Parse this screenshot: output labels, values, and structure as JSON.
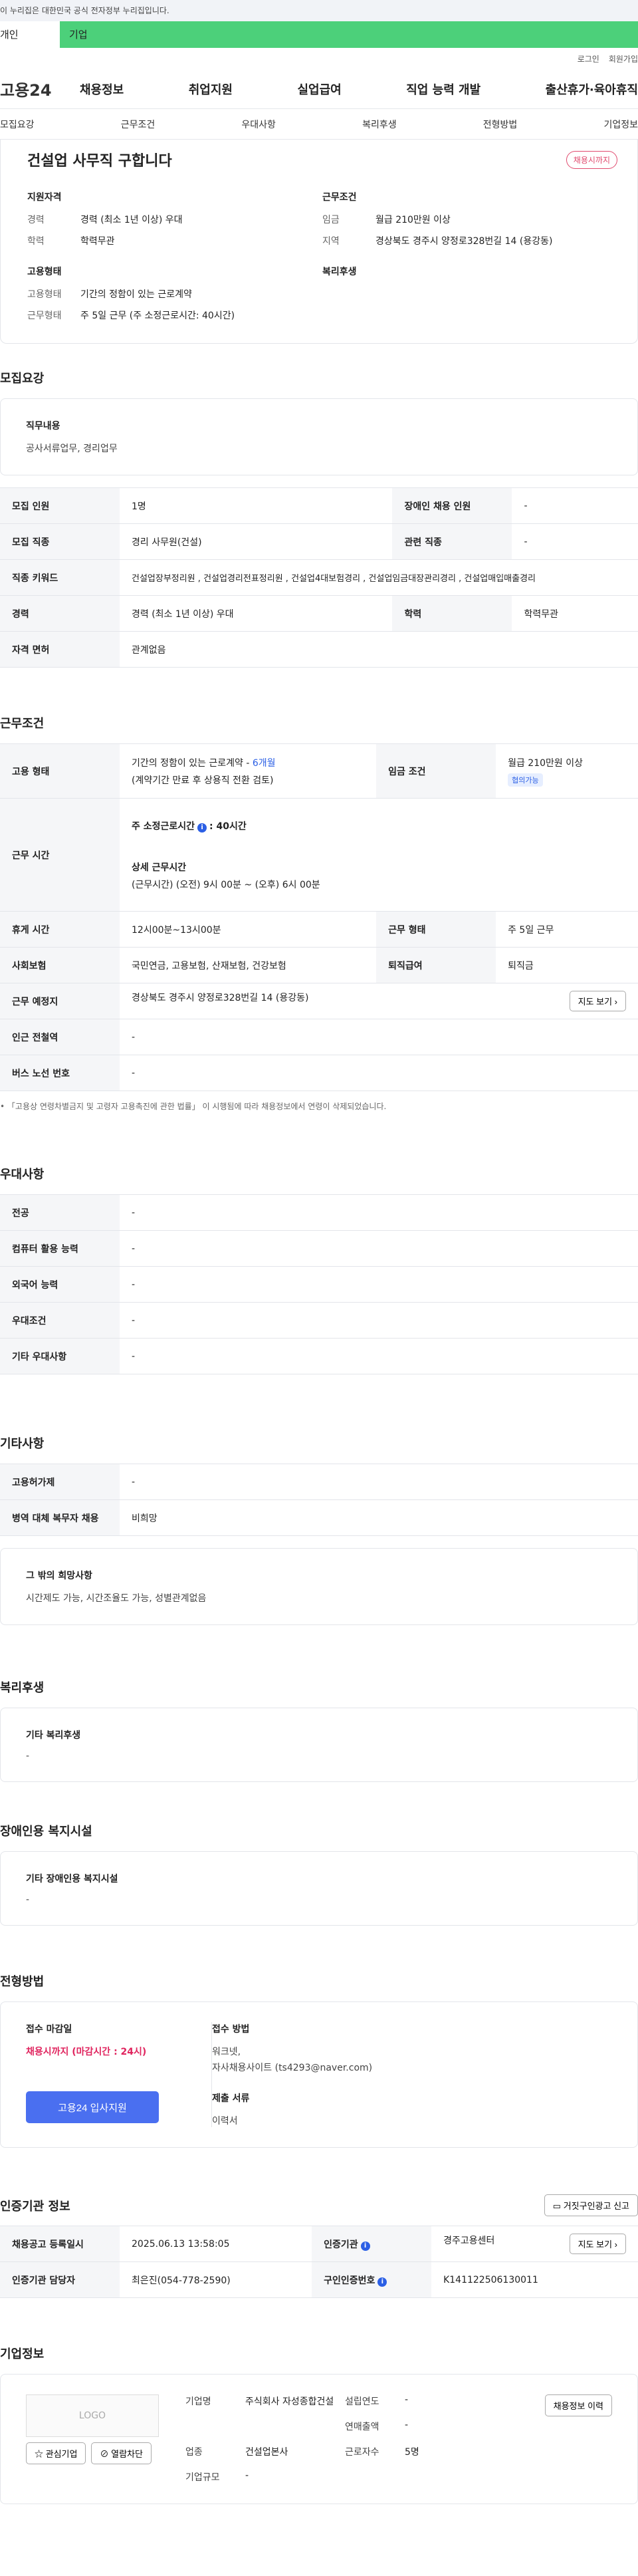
{
  "gov_banner": "이 누리집은 대한민국 공식 전자정부 누리집입니다.",
  "top_tabs": {
    "personal": "개인",
    "company": "기업"
  },
  "util": {
    "login": "로그인",
    "signup": "회원가입"
  },
  "gnb": {
    "logo": "고용24",
    "items": [
      "채용정보",
      "취업지원",
      "실업급여",
      "직업 능력 개발",
      "출산휴가·육아휴직"
    ]
  },
  "subnav": [
    "모집요강",
    "근무조건",
    "우대사항",
    "복리후생",
    "전형방법",
    "기업정보"
  ],
  "summary": {
    "title": "건설업 사무직 구합니다",
    "status": "채용시까지",
    "qual_label": "지원자격",
    "qual_rows": [
      {
        "k": "경력",
        "v": "경력 (최소 1년 이상) 우대"
      },
      {
        "k": "학력",
        "v": "학력무관"
      }
    ],
    "work_label": "근무조건",
    "work_rows": [
      {
        "k": "임금",
        "v": "월급 210만원 이상"
      },
      {
        "k": "지역",
        "v": "경상북도 경주시 양정로328번길 14 (용강동)"
      }
    ],
    "employ_label": "고용형태",
    "employ_rows": [
      {
        "k": "고용형태",
        "v": "기간의 정함이 있는 근로계약"
      },
      {
        "k": "근무형태",
        "v": "주 5일 근무 (주 소정근로시간: 40시간)"
      }
    ],
    "welfare_label": "복리후생"
  },
  "recruit": {
    "title": "모집요강",
    "duty_label": "직무내용",
    "duty_text": "공사서류업무, 경리업무",
    "rows": [
      {
        "k1": "모집 인원",
        "v1": "1명",
        "k2": "장애인 채용 인원",
        "v2": "-"
      },
      {
        "k1": "모집 직종",
        "v1": "경리 사무원(건설)",
        "k2": "관련 직종",
        "v2": "-"
      },
      {
        "k1": "직종 키워드",
        "v1": "건설업장부정리원 , 건설업경리전표정리원 , 건설업4대보험경리 , 건설업임금대장관리경리 , 건설업매입매출경리",
        "k2": "",
        "v2": ""
      },
      {
        "k1": "경력",
        "v1": "경력 (최소 1년 이상) 우대",
        "k2": "학력",
        "v2": "학력무관"
      },
      {
        "k1": "자격 면허",
        "v1": "관계없음",
        "k2": "",
        "v2": ""
      }
    ]
  },
  "conditions": {
    "title": "근무조건",
    "employ_type_k": "고용 형태",
    "employ_type_v1": "기간의 정함이 있는 근로계약 -",
    "employ_type_months": "6개월",
    "employ_type_v2": "(계약기간 만료 후 상용직 전환 검토)",
    "wage_k": "임금 조건",
    "wage_v": "월급 210만원 이상",
    "wage_tag": "협의가능",
    "hours_k": "근무 시간",
    "hours_main_label": "주 소정근로시간",
    "hours_main_value": ": 40시간",
    "hours_detail_label": "상세 근무시간",
    "hours_detail_value": "(근무시간) (오전) 9시 00분 ~ (오후) 6시 00분",
    "break_k": "휴게 시간",
    "break_v": "12시00분~13시00분",
    "worktype_k": "근무 형태",
    "worktype_v": "주 5일 근무",
    "insurance_k": "사회보험",
    "insurance_v": "국민연금, 고용보험, 산재보험, 건강보험",
    "severance_k": "퇴직급여",
    "severance_v": "퇴직금",
    "location_k": "근무 예정지",
    "location_v": "경상북도 경주시 양정로328번길 14 (용강동)",
    "map_btn": "지도 보기",
    "subway_k": "인근 전철역",
    "subway_v": "-",
    "bus_k": "버스 노선 번호",
    "bus_v": "-",
    "note": "「고용상 연령차별금지 및 고령자 고용촉진에 관한 법률」 이 시행됨에 따라 채용정보에서 연령이 삭제되었습니다."
  },
  "preference": {
    "title": "우대사항",
    "rows": [
      {
        "k": "전공",
        "v": "-"
      },
      {
        "k": "컴퓨터 활용 능력",
        "v": "-"
      },
      {
        "k": "외국어 능력",
        "v": "-"
      },
      {
        "k": "우대조건",
        "v": "-"
      },
      {
        "k": "기타 우대사항",
        "v": "-"
      }
    ]
  },
  "etc": {
    "title": "기타사항",
    "rows": [
      {
        "k": "고용허가제",
        "v": "-"
      },
      {
        "k": "병역 대체 복무자 채용",
        "v": "비희망"
      }
    ],
    "hope_label": "그 밖의 희망사항",
    "hope_text": "시간제도 가능,  시간조율도 가능,  성별관계없음"
  },
  "welfare": {
    "title": "복리후생",
    "label": "기타 복리후생",
    "text": "-"
  },
  "disability": {
    "title": "장애인용 복지시설",
    "label": "기타 장애인용 복지시설",
    "text": "-"
  },
  "selection": {
    "title": "전형방법",
    "deadline_label": "접수 마감일",
    "deadline_value": "채용시까지 (마감시간 : 24시)",
    "apply_btn": "고용24 입사지원",
    "method_label": "접수 방법",
    "method_text1": "워크넷,",
    "method_text2": "자사채용사이트 (ts4293@naver.com)",
    "docs_label": "제출 서류",
    "docs_text": "이력서"
  },
  "agency": {
    "title": "인증기관 정보",
    "report_btn": "거짓구인광고 신고",
    "rows": [
      {
        "k1": "채용공고 등록일시",
        "v1": "2025.06.13 13:58:05",
        "k2": "인증기관",
        "v2": "경주고용센터"
      },
      {
        "k1": "인증기관 담당자",
        "v1": "최은진(054-778-2590)",
        "k2": "구인인증번호",
        "v2": "K141122506130011"
      }
    ],
    "map_btn": "지도 보기"
  },
  "company": {
    "title": "기업정보",
    "logo": "LOGO",
    "interest_btn": "관심기업",
    "block_btn": "열람차단",
    "history_btn": "채용정보 이력",
    "fields": [
      {
        "k": "기업명",
        "v": "주식회사 자성종합건설"
      },
      {
        "k": "설립연도",
        "v": "-"
      },
      {
        "k": "",
        "v": ""
      },
      {
        "k": "연매출액",
        "v": "-"
      },
      {
        "k": "업종",
        "v": "건설업본사"
      },
      {
        "k": "근로자수",
        "v": "5명"
      },
      {
        "k": "기업규모",
        "v": "-"
      },
      {
        "k": "",
        "v": ""
      }
    ]
  }
}
